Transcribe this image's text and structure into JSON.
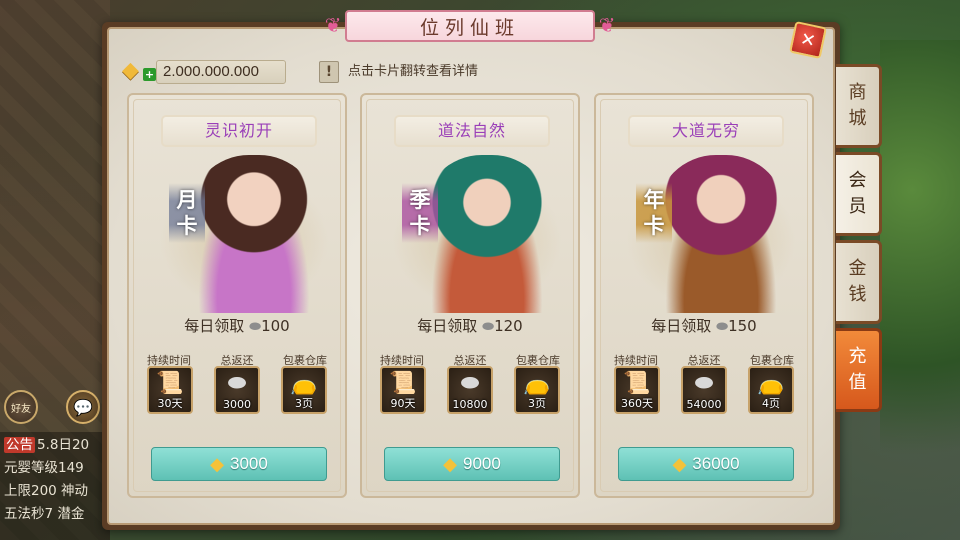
{
  "panel": {
    "title": "位列仙班",
    "gold_amount": "2.000.000.000",
    "hint": "点击卡片翻转查看详情",
    "hint_icon": "!"
  },
  "chat": {
    "friends_label": "好友",
    "lines": [
      {
        "tag": "公告",
        "text": "5.8日20"
      },
      {
        "text": "元婴等级149"
      },
      {
        "text": "上限200 神动"
      },
      {
        "text": "五法秒7 潜金"
      }
    ]
  },
  "stat_labels": [
    "持续时间",
    "总返还",
    "包裹仓库"
  ],
  "cards": [
    {
      "title": "灵识初开",
      "tag_top": "月",
      "tag_bottom": "卡",
      "daily_label": "每日领取",
      "daily_amount": "100",
      "duration": "30天",
      "duration_icon_text": "30",
      "total_return": "3000",
      "storage": "3页",
      "price": "3000"
    },
    {
      "title": "道法自然",
      "tag_top": "季",
      "tag_bottom": "卡",
      "daily_label": "每日领取",
      "daily_amount": "120",
      "duration": "90天",
      "duration_icon_text": "90",
      "total_return": "10800",
      "storage": "3页",
      "price": "9000"
    },
    {
      "title": "大道无穷",
      "tag_top": "年",
      "tag_bottom": "卡",
      "daily_label": "每日领取",
      "daily_amount": "150",
      "duration": "360天",
      "duration_icon_text": "360",
      "total_return": "54000",
      "storage": "4页",
      "price": "36000"
    }
  ],
  "tabs": [
    {
      "top": "商",
      "bottom": "城"
    },
    {
      "top": "会",
      "bottom": "员"
    },
    {
      "top": "金",
      "bottom": "钱"
    },
    {
      "top": "充",
      "bottom": "值"
    }
  ],
  "colors": {
    "panel_frame": "#5a3c24",
    "card_title_text": "#9a3fb8",
    "buy_button": "#5ec1b4",
    "recharge_tab": "#d6581c"
  },
  "icons": {
    "gold": "gold-ingot-icon",
    "silver": "silver-ingot-icon",
    "close": "close-icon"
  }
}
